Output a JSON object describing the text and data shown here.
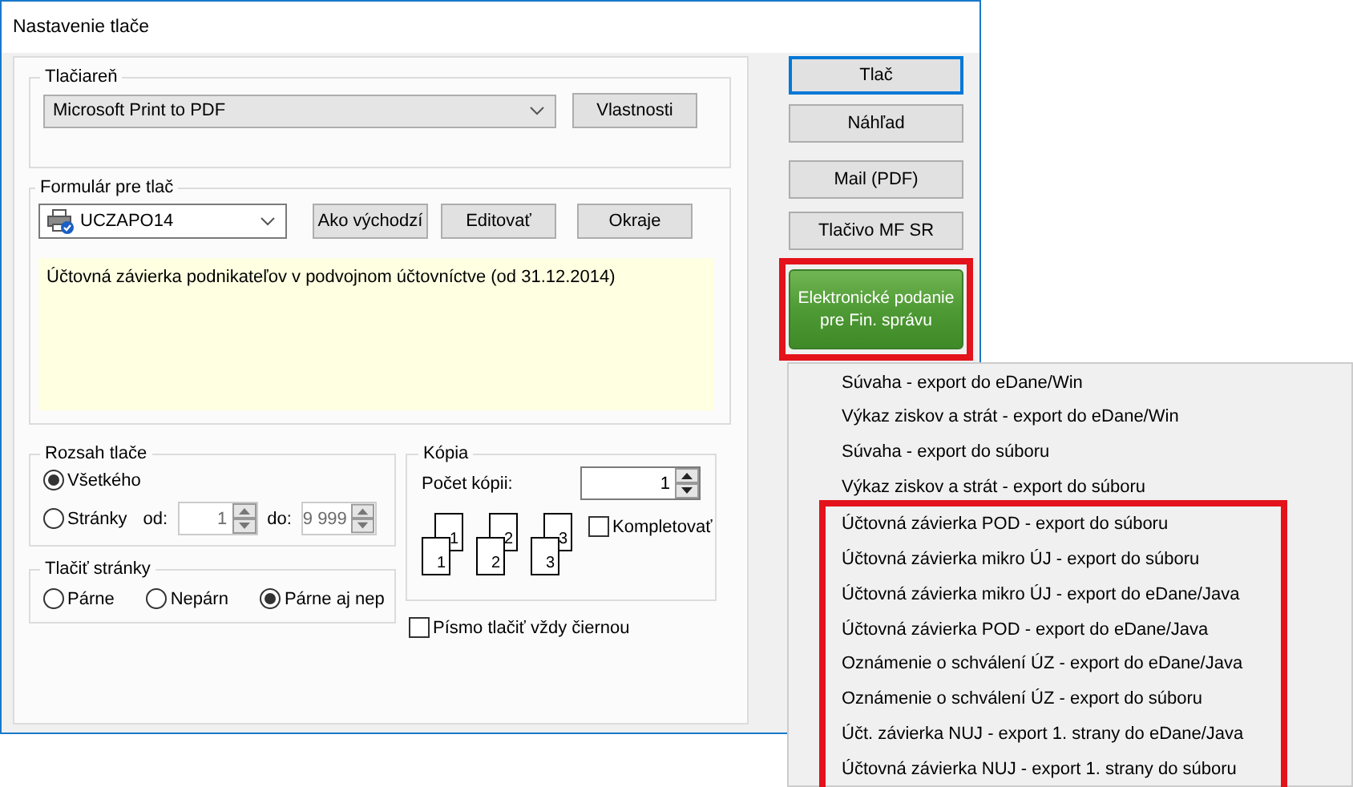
{
  "window": {
    "title": "Nastavenie tlače"
  },
  "printer": {
    "label": "Tlačiareň",
    "value": "Microsoft Print to PDF",
    "button": "Vlastnosti"
  },
  "form": {
    "label": "Formulár pre tlač",
    "value": "UCZAPO14",
    "buttons": [
      "Ako východzí",
      "Editovať",
      "Okraje"
    ],
    "description": "Účtovná závierka podnikateľov v podvojnom účtovníctve (od 31.12.2014)"
  },
  "range": {
    "label": "Rozsah tlače",
    "options": [
      {
        "label": "Všetkého",
        "selected": true
      },
      {
        "label": "Stránky",
        "selected": false
      }
    ],
    "from": {
      "label": "od:",
      "value": "1",
      "disabled": true
    },
    "to": {
      "label": "do:",
      "value": "9 999",
      "disabled": true
    }
  },
  "pages": {
    "label": "Tlačiť stránky",
    "options": [
      {
        "label": "Párne",
        "selected": false
      },
      {
        "label": "Nepárn",
        "selected": false
      },
      {
        "label": "Párne aj nep",
        "selected": true
      }
    ]
  },
  "copies": {
    "label": "Kópia",
    "count_label": "Počet kópii:",
    "count": "1",
    "sheets": [
      {
        "back_number": "1",
        "front_number": "1"
      },
      {
        "back_number": "2",
        "front_number": "2"
      },
      {
        "back_number": "3",
        "front_number": "3"
      }
    ],
    "collate": {
      "label": "Kompletovať",
      "checked": false
    }
  },
  "black_font": {
    "label": "Písmo tlačiť vždy čiernou",
    "checked": false
  },
  "actions": [
    {
      "label": "Tlač",
      "kind": "default",
      "highlighted": false
    },
    {
      "label": "Náhľad",
      "kind": "plain",
      "highlighted": false
    },
    {
      "label": "Mail (PDF)",
      "kind": "plain",
      "highlighted": false
    },
    {
      "label": "Tlačivo MF SR",
      "kind": "plain",
      "highlighted": false
    },
    {
      "label": "Elektronické podanie pre Fin. správu",
      "kind": "green",
      "highlighted": true
    }
  ],
  "menu": {
    "items": [
      {
        "label": "Súvaha - export do eDane/Win",
        "highlighted": false
      },
      {
        "label": "Výkaz  ziskov a strát - export do eDane/Win",
        "highlighted": false
      },
      {
        "label": "Súvaha - export do súboru",
        "highlighted": false
      },
      {
        "label": "Výkaz  ziskov a strát - export do súboru",
        "highlighted": false
      },
      {
        "label": "Účtovná závierka POD - export do súboru",
        "highlighted": true
      },
      {
        "label": "Účtovná závierka mikro ÚJ - export do súboru",
        "highlighted": true
      },
      {
        "label": "Účtovná závierka mikro ÚJ - export do eDane/Java",
        "highlighted": true
      },
      {
        "label": "Účtovná závierka POD - export do eDane/Java",
        "highlighted": true
      },
      {
        "label": "Oznámenie o schválení ÚZ - export do eDane/Java",
        "highlighted": true
      },
      {
        "label": "Oznámenie o schválení ÚZ - export do súboru",
        "highlighted": true
      },
      {
        "label": "Účt. závierka NUJ - export 1. strany do eDane/Java",
        "highlighted": true
      },
      {
        "label": "Účtovná závierka NUJ - export 1. strany do súboru",
        "highlighted": true
      }
    ]
  }
}
